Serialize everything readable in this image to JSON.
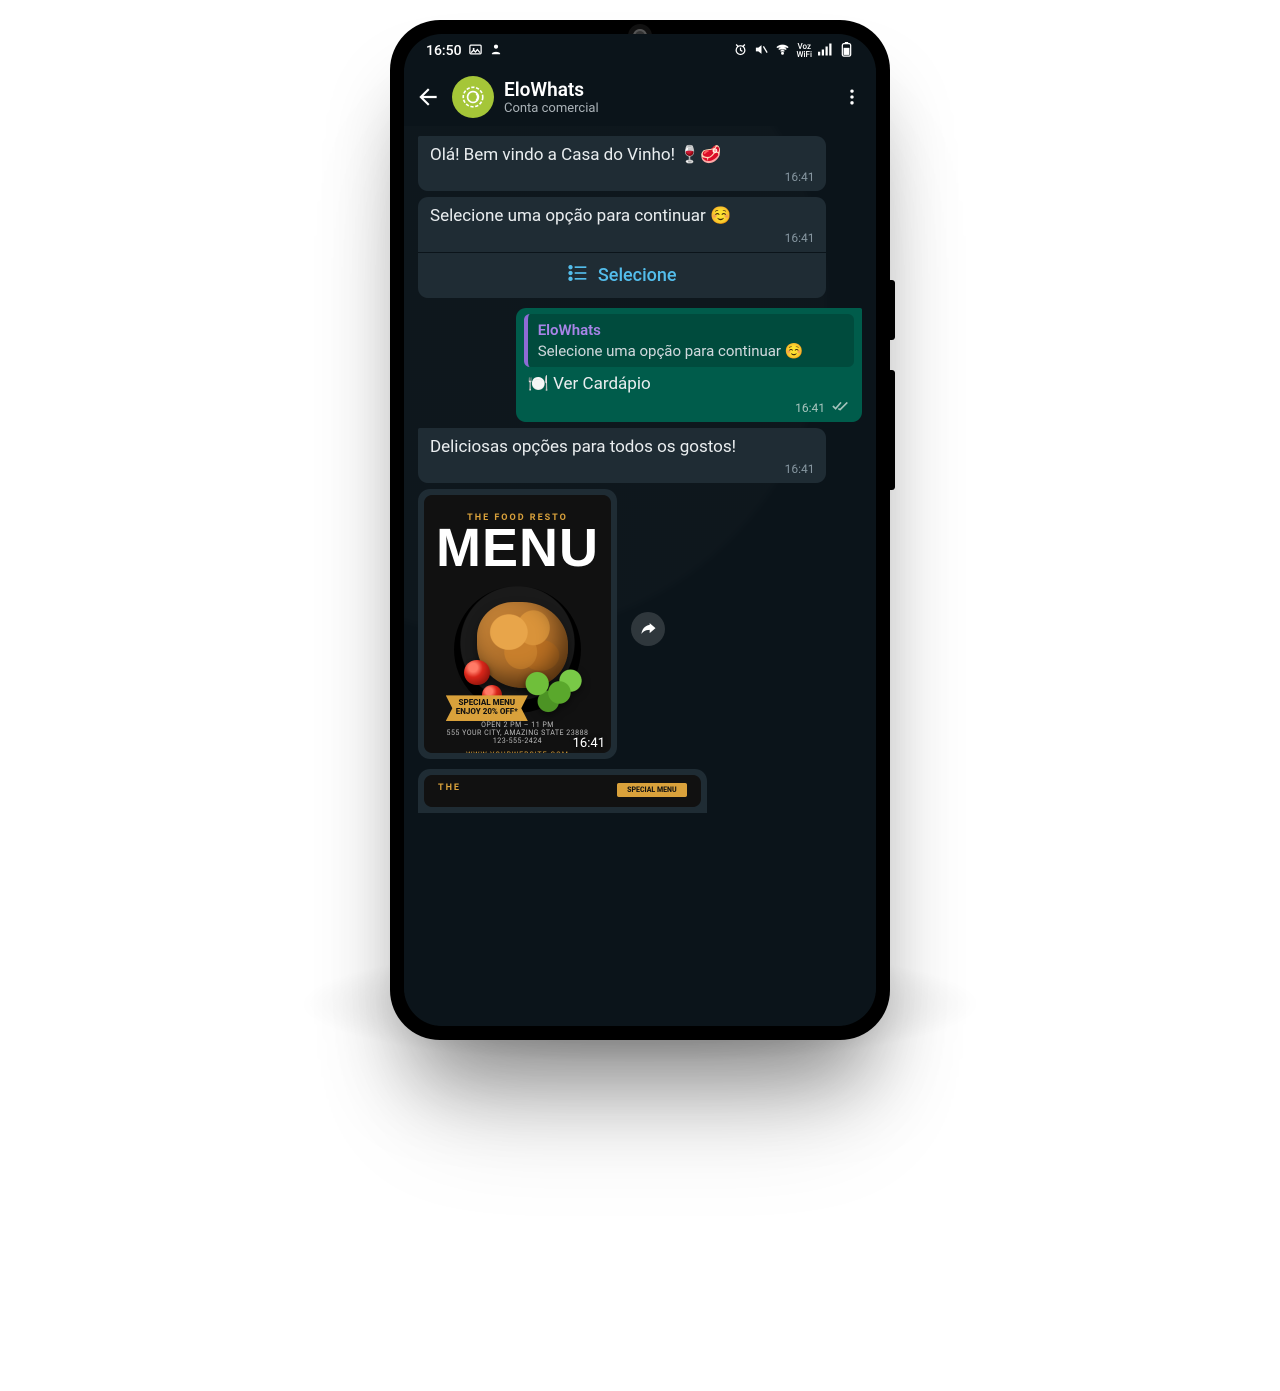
{
  "status": {
    "time": "16:50",
    "voz_top": "Voz",
    "voz_bottom": "WiFi"
  },
  "header": {
    "name": "EloWhats",
    "subtitle": "Conta comercial"
  },
  "messages": {
    "m1_text": "Olá! Bem vindo a Casa do Vinho! 🍷🥩",
    "m1_time": "16:41",
    "m2_text": "Selecione uma opção para continuar ☺️",
    "m2_time": "16:41",
    "select_btn": "Selecione",
    "m3_quote_name": "EloWhats",
    "m3_quote_text": "Selecione uma opção para continuar ☺️",
    "m3_text": "🍽️ Ver Cardápio",
    "m3_time": "16:41",
    "m4_text": "Deliciosas opções para todos os gostos!",
    "m4_time": "16:41",
    "img_time": "16:41"
  },
  "menu_card": {
    "tag": "THE FOOD RESTO",
    "big": "MENU",
    "ribbon_l1": "SPECIAL MENU",
    "ribbon_l2": "ENJOY 20% OFF*",
    "foot1": "OPEN 2 PM – 11 PM",
    "foot2": "555 YOUR CITY, AMAZING STATE 23888",
    "foot3": "123-555-2424",
    "site": "WWW.YOURWEBSITE.COM"
  },
  "peek": {
    "left": "THE",
    "right": "SPECIAL MENU"
  }
}
